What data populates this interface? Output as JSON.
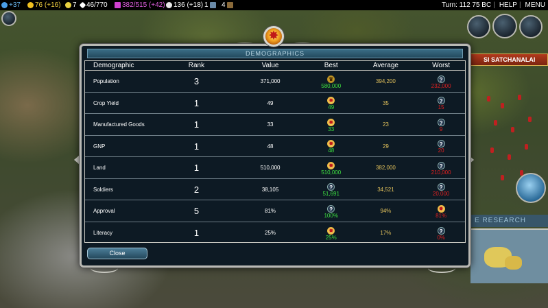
{
  "topbar": {
    "science": "+37",
    "gold": "76 (+16)",
    "happiness": "7",
    "golden_age": "46/770",
    "culture": "382/515 (+42)",
    "faith": "136 (+18)",
    "great_people": "1",
    "strategic": "4",
    "turn": "Turn: 112  75 BC",
    "help": "HELP",
    "menu": "MENU",
    "colors": {
      "science": "#4a9ee8",
      "gold": "#f0c020",
      "happiness": "#e8d040",
      "culture": "#d040d0",
      "faith": "#e8e8e8"
    }
  },
  "hud": {
    "city_banner": "SI SATCHANALAI",
    "research_label": "E RESEARCH"
  },
  "dialog": {
    "title": "DEMOGRAPHICS",
    "emblem_glyph": "✸",
    "close_label": "Close",
    "columns": [
      "Demographic",
      "Rank",
      "Value",
      "Best",
      "Average",
      "Worst"
    ],
    "rows": [
      {
        "name": "Population",
        "rank": "3",
        "value": "371,000",
        "best_icon": "crown",
        "best_glyph": "♛",
        "best": "580,000",
        "average": "394,200",
        "worst_icon": "q",
        "worst_glyph": "?",
        "worst": "232,000"
      },
      {
        "name": "Crop Yield",
        "rank": "1",
        "value": "49",
        "best_icon": "star",
        "best_glyph": "✸",
        "best": "49",
        "average": "35",
        "worst_icon": "q",
        "worst_glyph": "?",
        "worst": "15"
      },
      {
        "name": "Manufactured Goods",
        "rank": "1",
        "value": "33",
        "best_icon": "star",
        "best_glyph": "✸",
        "best": "33",
        "average": "23",
        "worst_icon": "q",
        "worst_glyph": "?",
        "worst": "9"
      },
      {
        "name": "GNP",
        "rank": "1",
        "value": "48",
        "best_icon": "star",
        "best_glyph": "✸",
        "best": "48",
        "average": "29",
        "worst_icon": "q",
        "worst_glyph": "?",
        "worst": "20"
      },
      {
        "name": "Land",
        "rank": "1",
        "value": "510,000",
        "best_icon": "star",
        "best_glyph": "✸",
        "best": "510,000",
        "average": "382,000",
        "worst_icon": "q",
        "worst_glyph": "?",
        "worst": "210,000"
      },
      {
        "name": "Soldiers",
        "rank": "2",
        "value": "38,105",
        "best_icon": "q",
        "best_glyph": "?",
        "best": "51,691",
        "average": "34,521",
        "worst_icon": "q",
        "worst_glyph": "?",
        "worst": "20,000"
      },
      {
        "name": "Approval",
        "rank": "5",
        "value": "81%",
        "best_icon": "q",
        "best_glyph": "?",
        "best": "100%",
        "average": "94%",
        "worst_icon": "star",
        "worst_glyph": "✸",
        "worst": "81%"
      },
      {
        "name": "Literacy",
        "rank": "1",
        "value": "25%",
        "best_icon": "star",
        "best_glyph": "✸",
        "best": "25%",
        "average": "17%",
        "worst_icon": "q",
        "worst_glyph": "?",
        "worst": "0%"
      }
    ]
  }
}
